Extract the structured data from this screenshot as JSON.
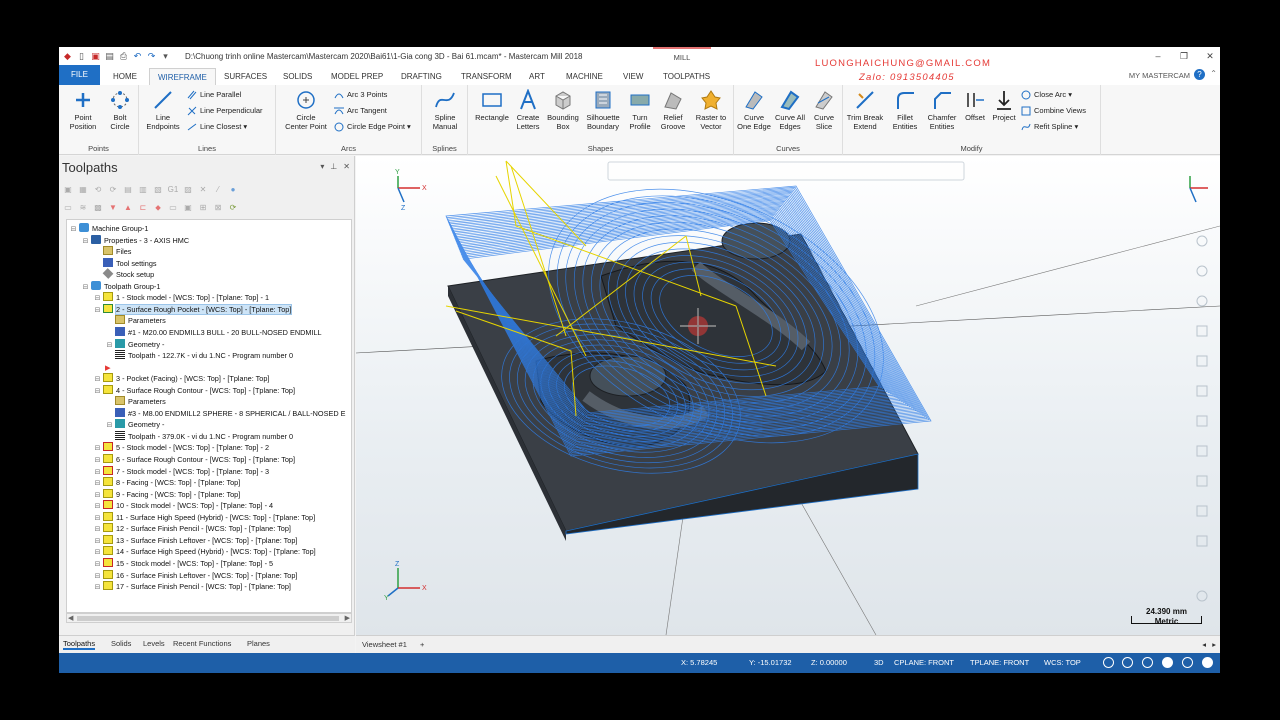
{
  "window": {
    "title": "D:\\Chuong trinh online Mastercam\\Mastercam 2020\\Bai61\\1-Gia cong 3D - Bai 61.mcam* - Mastercam Mill 2018",
    "context_tab": "MILL",
    "overlay_email": "LUONGHAICHUNG@GMAIL.COM",
    "overlay_phone": "Zalo: 0913504405",
    "account": "MY MASTERCAM"
  },
  "menu": [
    "FILE",
    "HOME",
    "WIREFRAME",
    "SURFACES",
    "SOLIDS",
    "MODEL PREP",
    "DRAFTING",
    "TRANSFORM",
    "ART",
    "MACHINE",
    "VIEW",
    "TOOLPATHS"
  ],
  "ribbon": {
    "points": {
      "label": "Points",
      "point_position": "Point\nPosition",
      "bolt_circle": "Bolt\nCircle"
    },
    "lines": {
      "label": "Lines",
      "line_endpoints": "Line\nEndpoints",
      "line_parallel": "Line Parallel",
      "line_perpendicular": "Line Perpendicular",
      "line_closest": "Line Closest"
    },
    "arcs": {
      "label": "Arcs",
      "circle_center_point": "Circle\nCenter Point",
      "arc_3_points": "Arc 3 Points",
      "arc_tangent": "Arc Tangent",
      "circle_edge_point": "Circle Edge Point"
    },
    "splines": {
      "label": "Splines",
      "spline_manual": "Spline\nManual"
    },
    "shapes": {
      "label": "Shapes",
      "rectangle": "Rectangle",
      "create_letters": "Create\nLetters",
      "bounding_box": "Bounding\nBox",
      "silhouette_boundary": "Silhouette\nBoundary",
      "turn_profile": "Turn\nProfile",
      "relief_groove": "Relief\nGroove",
      "raster_to_vector": "Raster to\nVector"
    },
    "curves": {
      "label": "Curves",
      "curve_one_edge": "Curve\nOne Edge",
      "curve_all_edges": "Curve All\nEdges",
      "curve_slice": "Curve\nSlice"
    },
    "modify": {
      "label": "Modify",
      "trim_break_extend": "Trim Break\nExtend",
      "fillet_entities": "Fillet\nEntities",
      "chamfer_entities": "Chamfer\nEntities",
      "offset": "Offset",
      "project": "Project",
      "close_arc": "Close Arc",
      "combine_views": "Combine Views",
      "refit_spline": "Refit Spline"
    }
  },
  "toolpaths_panel": {
    "title": "Toolpaths",
    "tree": [
      "Machine Group-1",
      "Properties - 3 - AXIS HMC",
      "Files",
      "Tool settings",
      "Stock setup",
      "Toolpath Group-1",
      "1 - Stock model - [WCS: Top] - [Tplane: Top] - 1",
      "2 - Surface Rough Pocket - [WCS: Top] - [Tplane: Top]",
      "Parameters",
      "#1 - M20.00 ENDMILL3 BULL - 20 BULL-NOSED ENDMILL",
      "Geometry -",
      "Toolpath - 122.7K - vi du 1.NC - Program number 0",
      "3 - Pocket (Facing) - [WCS: Top] - [Tplane: Top]",
      "4 - Surface Rough Contour - [WCS: Top] - [Tplane: Top]",
      "Parameters",
      "#3 - M8.00 ENDMILL2 SPHERE - 8 SPHERICAL / BALL-NOSED E",
      "Geometry -",
      "Toolpath - 379.0K - vi du 1.NC - Program number 0",
      "5 - Stock model - [WCS: Top] - [Tplane: Top] - 2",
      "6 - Surface Rough Contour - [WCS: Top] - [Tplane: Top]",
      "7 - Stock model - [WCS: Top] - [Tplane: Top] - 3",
      "8 - Facing - [WCS: Top] - [Tplane: Top]",
      "9 - Facing - [WCS: Top] - [Tplane: Top]",
      "10 - Stock model - [WCS: Top] - [Tplane: Top] - 4",
      "11 - Surface High Speed (Hybrid) - [WCS: Top] - [Tplane: Top]",
      "12 - Surface Finish Pencil - [WCS: Top] - [Tplane: Top]",
      "13 - Surface Finish Leftover - [WCS: Top] - [Tplane: Top]",
      "14 - Surface High Speed (Hybrid) - [WCS: Top] - [Tplane: Top]",
      "15 - Stock model - [WCS: Top] - [Tplane: Top] - 5",
      "16 - Surface Finish Leftover - [WCS: Top] - [Tplane: Top]",
      "17 - Surface Finish Pencil - [WCS: Top] - [Tplane: Top]"
    ],
    "tabs": [
      "Toolpaths",
      "Solids",
      "Levels",
      "Recent Functions",
      "Planes"
    ]
  },
  "viewport": {
    "viewsheet": "Viewsheet #1",
    "scale_value": "24.390 mm",
    "scale_unit": "Metric"
  },
  "status": {
    "x": "X:  5.78245",
    "y": "Y:  -15.01732",
    "z": "Z:  0.00000",
    "mode": "3D",
    "cplane": "CPLANE: FRONT",
    "tplane": "TPLANE: FRONT",
    "wcs": "WCS: TOP"
  },
  "colors": {
    "accent": "#1f6fc5",
    "status_bar": "#1e5fa8",
    "toolpath": "#2f7ee8",
    "rapid": "#e6d400",
    "overlay_text": "#e53935"
  }
}
